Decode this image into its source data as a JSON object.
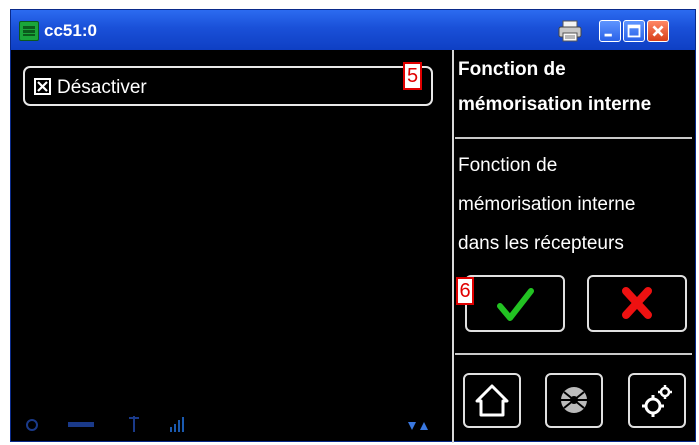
{
  "window": {
    "title": "cc51:0"
  },
  "option": {
    "label": "Désactiver",
    "checked": true
  },
  "panel": {
    "title_line1": "Fonction de",
    "title_line2": "mémorisation interne",
    "description_line1": "Fonction de",
    "description_line2": "mémorisation interne",
    "description_line3": "dans les récepteurs"
  },
  "markers": {
    "option_marker": "5",
    "confirm_marker": "6"
  },
  "icons": {
    "app": "app-icon",
    "print": "printer-icon",
    "minimize": "minimize-icon",
    "maximize": "maximize-icon",
    "close": "close-icon",
    "ok": "checkmark-icon",
    "cancel": "cross-icon",
    "home": "home-icon",
    "network": "network-icon",
    "settings": "gears-icon"
  },
  "colors": {
    "titlebar": "#1a50d8",
    "background": "#000000",
    "confirm": "#22c222",
    "cancel": "#ee1111",
    "marker": "#e00000"
  }
}
